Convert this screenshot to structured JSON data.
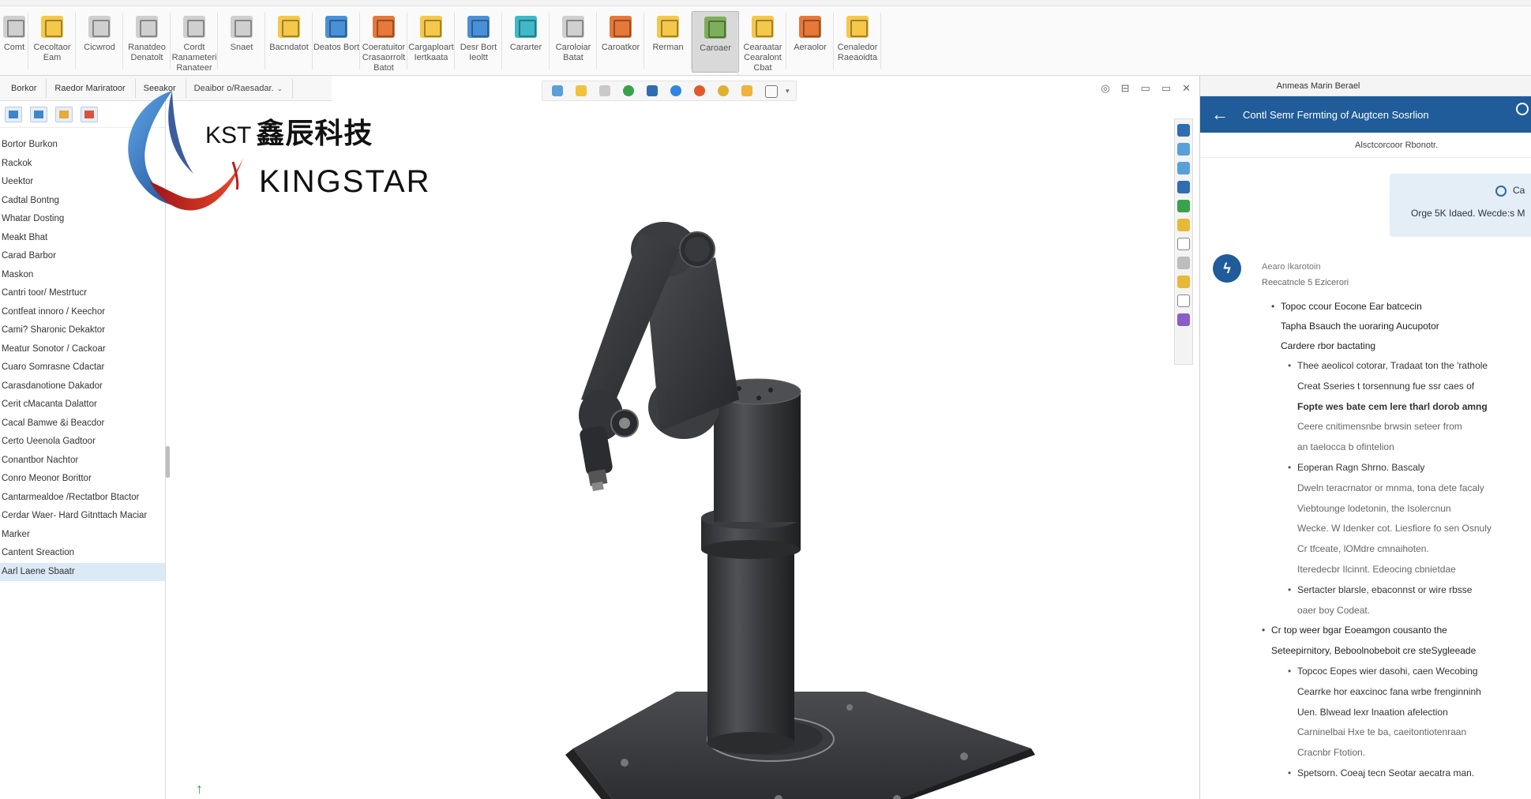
{
  "ribbon": {
    "buttons": [
      {
        "label": "Comt",
        "icon": "document-icon",
        "color": "g"
      },
      {
        "label": "Cecoltaor Eam",
        "label2": "",
        "icon": "sketch-icon",
        "color": "y"
      },
      {
        "label": "Cicwrod",
        "label2": "",
        "icon": "smart-dimension-icon",
        "color": "g"
      },
      {
        "label": "Ranatdeo",
        "label2": "Denatolt",
        "icon": "feature-icon",
        "color": "g"
      },
      {
        "label": "Cordt Ranameteri",
        "label2": "Ranateer",
        "icon": "param-icon",
        "color": "g"
      },
      {
        "label": "Snaet",
        "label2": "",
        "icon": "small-icon",
        "color": "g"
      },
      {
        "label": "Bacndatot",
        "label2": "",
        "icon": "assembly-icon",
        "color": "y"
      },
      {
        "label": "Deatos Bort",
        "label2": "",
        "icon": "part-icon",
        "color": "b"
      },
      {
        "label": "Coeratuitor",
        "label2": "Crasaorrolt Batot",
        "icon": "motion-icon",
        "color": "o"
      },
      {
        "label": "Cargaploart",
        "label2": "Iertkaata",
        "icon": "plan-icon",
        "color": "y"
      },
      {
        "label": "Desr Bort",
        "label2": "Ieoltt",
        "icon": "design-icon",
        "color": "b"
      },
      {
        "label": "Cararter",
        "label2": "",
        "icon": "draw-icon",
        "color": "c"
      },
      {
        "label": "Caroloiar",
        "label2": "Batat",
        "icon": "draft-icon",
        "color": "g"
      },
      {
        "label": "Caroatkor",
        "label2": "",
        "icon": "chart-icon",
        "color": "o"
      },
      {
        "label": "Rerman",
        "label2": "",
        "icon": "pen-icon",
        "color": "y"
      },
      {
        "label": "Caroaer",
        "label2": "",
        "icon": "ai-generate-icon",
        "color": "gr",
        "active": true
      },
      {
        "label": "Cearaatar",
        "label2": "Cearalont Cbat",
        "icon": "edit-icon",
        "color": "y"
      },
      {
        "label": "Aeraolor",
        "label2": "",
        "icon": "render-icon",
        "color": "o"
      },
      {
        "label": "Cenaledor",
        "label2": "Raeaoidta",
        "icon": "report-icon",
        "color": "y"
      }
    ]
  },
  "left_tabs": [
    "Borkor",
    "Raedor  Mariratoor",
    "Seeakor",
    "Deaibor o/Raesadar."
  ],
  "tree_items": [
    "Bortor Burkon",
    "Rackok",
    "Ueektor",
    "Cadtal Bontng",
    "Whatar Dosting",
    "Meakt Bhat",
    "Carad Barbor",
    "Maskon",
    "Cantri toor/ Mestrtucr",
    "Contfeat innoro / Keechor",
    "Cami? Sharonic Dekaktor",
    "Meatur Sonotor / Cackoar",
    "Cuaro Somrasne Cdactar",
    "Carasdanotione Dakador",
    "Cerit cMacanta Dalattor",
    "Cacal Bamwe &i Beacdor",
    "Certo Ueenola Gadtoor",
    "Conantbor Nachtor",
    "Conro Meonor Borittor",
    "Cantarmealdoe /Rectatbor Btactor",
    "Cerdar Waer- Hard Gitnttach Maciar",
    "Marker",
    "Cantent Sreaction",
    "Aarl Laene Sbaatr"
  ],
  "logo": {
    "abbr": "KST",
    "cn": "鑫辰科技",
    "en": "KINGSTAR",
    "brand_blue": "#1f4fa0",
    "brand_red": "#d8262c"
  },
  "viewport": {
    "controls": [
      "◎",
      "⊟",
      "▭",
      "▭",
      "✕"
    ]
  },
  "ai_panel": {
    "top_title": "Anmeas Marin Berael",
    "header_title": "Contl Semr Fermting of Augtcen Sosrlion",
    "subheader": "Alsctcorcoor Rbonotr.",
    "user_message": {
      "line1": "Ca",
      "line2": "Orge 5K Idaed. Wecde:s M"
    },
    "response": {
      "meta1": "Aearo Ikarotoin",
      "meta2": "Reecatncle 5 Ezicerori",
      "lines": [
        {
          "level": 1,
          "bullet": true,
          "text": "Topoc ccour Eocone Ear batcecin"
        },
        {
          "level": 1,
          "bullet": false,
          "text": "Tapha Bsauch  the  uoraring  Aucupotor"
        },
        {
          "level": 1,
          "bullet": false,
          "text": "Cardere rbor bactating"
        },
        {
          "level": 2,
          "bullet": true,
          "text": "Thee  aeolicol  cotorar,  Tradaat  ton  the  'rathole"
        },
        {
          "level": 2,
          "bullet": false,
          "text": "Creat  Sseries t  torsennung  fue  ssr  caes of"
        },
        {
          "level": 2,
          "bullet": false,
          "text": "Fopte  wes  bate  cem  lere  tharl  dorob  amng",
          "bold": true
        },
        {
          "level": 2,
          "bullet": false,
          "text": "Ceere  cnitimensnbe  brwsin  seteer  from",
          "gray": true
        },
        {
          "level": 2,
          "bullet": false,
          "text": "an taelocca b ofintelion",
          "gray": true
        },
        {
          "level": 2,
          "bullet": true,
          "text": "Eoperan  Ragn  Shrno.  Bascaly"
        },
        {
          "level": 2,
          "bullet": false,
          "text": "Dweln  teracrnator  or  mnma,  tona  dete facaly",
          "gray": true
        },
        {
          "level": 2,
          "bullet": false,
          "text": "Viebtounge  lodetonin,  the  Isolercnun",
          "gray": true
        },
        {
          "level": 2,
          "bullet": false,
          "text": "Wecke.  W Idenker  cot.  Liesfiore  fo sen  Osnuly",
          "gray": true
        },
        {
          "level": 2,
          "bullet": false,
          "text": "Cr tfceate,  lOMdre  cmnaihoten.",
          "gray": true
        },
        {
          "level": 2,
          "bullet": false,
          "text": "Iteredecbr  Ilcinnt.  Edeocing  cbnietdae",
          "gray": true
        },
        {
          "level": 2,
          "bullet": true,
          "text": "Sertacter  blarsle,  ebaconnst  or  wire  rbsse"
        },
        {
          "level": 2,
          "bullet": false,
          "text": "oaer boy  Codeat.",
          "gray": true
        },
        {
          "level": 0,
          "bullet": true,
          "text": "Cr top  weer  bgar  Eoeamgon  cousanto  the"
        },
        {
          "level": 0,
          "bullet": false,
          "text": "Seteepirnitory,  Beboolnobeboit  cre  steSygleeade",
          "gray": true
        },
        {
          "level": 2,
          "bullet": true,
          "text": "Topcoc  Eopes  wier dasohi,  caen  Wecobing"
        },
        {
          "level": 2,
          "bullet": false,
          "text": "Cearrke  hor  eaxcinoc  fana  wrbe  frenginninh"
        },
        {
          "level": 2,
          "bullet": false,
          "text": "Uen.  Blwead  lexr  lnaation  afelection"
        },
        {
          "level": 2,
          "bullet": false,
          "text": "Carninelbai Hxe  te  ba,  caeitontiotenraan",
          "gray": true
        },
        {
          "level": 2,
          "bullet": false,
          "text": "Cracnbr Ftotion.",
          "gray": true
        },
        {
          "level": 2,
          "bullet": true,
          "text": "Spetsorn.  Coeaj  tecn  Seotar  aecatra  man."
        }
      ]
    }
  },
  "colors": {
    "accent": "#1f5c99",
    "selection": "#dce9f7",
    "robot_body": "#3a3b3d"
  }
}
